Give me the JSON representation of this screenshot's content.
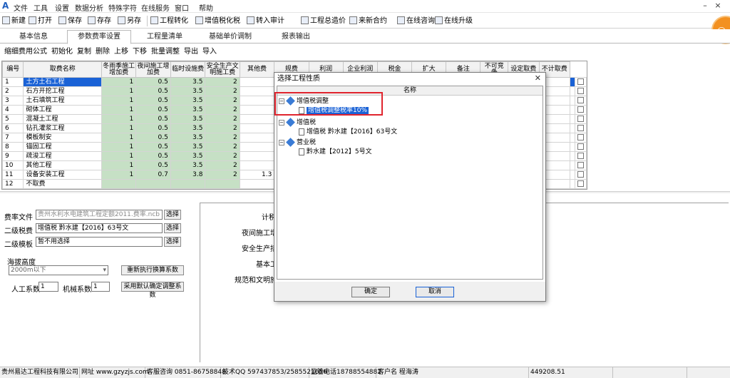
{
  "menubar": {
    "items": [
      "文件",
      "工具",
      "设置",
      "数据分析",
      "特殊字符",
      "在线服务",
      "窗口",
      "帮助"
    ]
  },
  "toolbar": {
    "items": [
      "新建",
      "打开",
      "保存",
      "存存",
      "另存",
      "工程转化",
      "增值税化税",
      "转入审计",
      "工程总造价",
      "来新合约",
      "在线咨询",
      "在线升级"
    ]
  },
  "tabs": [
    "基本信息",
    "参数费率设置",
    "工程量清单",
    "基础单价调制",
    "报表输出"
  ],
  "active_tab_index": 1,
  "subtoolbar": [
    "缩细费用公式",
    "初始化",
    "复制",
    "删除",
    "上移",
    "下移",
    "批量调整",
    "导出",
    "导入"
  ],
  "grid": {
    "headers": [
      "编号",
      "取费名称",
      "冬雨季施工增加费",
      "夜间施工增加费",
      "临时设施费",
      "安全生产文明施工费",
      "其他费",
      "规费",
      "利润",
      "企业利润",
      "税金",
      "扩大",
      "备注",
      "不可竞争",
      "设定取费",
      "不计取费"
    ],
    "rows": [
      {
        "no": "1",
        "name": "土方土石工程",
        "v1": "1",
        "v2": "0.5",
        "v3": "3.5",
        "v4": "2",
        "v5": ""
      },
      {
        "no": "2",
        "name": "石方开挖工程",
        "v1": "1",
        "v2": "0.5",
        "v3": "3.5",
        "v4": "2",
        "v5": ""
      },
      {
        "no": "3",
        "name": "土石填筑工程",
        "v1": "1",
        "v2": "0.5",
        "v3": "3.5",
        "v4": "2",
        "v5": ""
      },
      {
        "no": "4",
        "name": "砌体工程",
        "v1": "1",
        "v2": "0.5",
        "v3": "3.5",
        "v4": "2",
        "v5": ""
      },
      {
        "no": "5",
        "name": "混凝土工程",
        "v1": "1",
        "v2": "0.5",
        "v3": "3.5",
        "v4": "2",
        "v5": ""
      },
      {
        "no": "6",
        "name": "钻孔灌浆工程",
        "v1": "1",
        "v2": "0.5",
        "v3": "3.5",
        "v4": "2",
        "v5": ""
      },
      {
        "no": "7",
        "name": "模板制安",
        "v1": "1",
        "v2": "0.5",
        "v3": "3.5",
        "v4": "2",
        "v5": ""
      },
      {
        "no": "8",
        "name": "锚固工程",
        "v1": "1",
        "v2": "0.5",
        "v3": "3.5",
        "v4": "2",
        "v5": ""
      },
      {
        "no": "9",
        "name": "疏浚工程",
        "v1": "1",
        "v2": "0.5",
        "v3": "3.5",
        "v4": "2",
        "v5": ""
      },
      {
        "no": "10",
        "name": "其他工程",
        "v1": "1",
        "v2": "0.5",
        "v3": "3.5",
        "v4": "2",
        "v5": ""
      },
      {
        "no": "11",
        "name": "设备安装工程",
        "v1": "1",
        "v2": "0.7",
        "v3": "3.8",
        "v4": "2",
        "v5": "1.3"
      },
      {
        "no": "12",
        "name": "不取费",
        "v1": "",
        "v2": "",
        "v3": "",
        "v4": "",
        "v5": ""
      }
    ],
    "selected_row_index": 0
  },
  "left_panel": {
    "fee_file_label": "费率文件",
    "fee_file_value": "贵州水利水电建筑工程定额2011.费率.ncb",
    "second_tax_label": "二级税费",
    "second_tax_value": "增值税 黔水建【2016】63号文",
    "second_template_label": "二级模板",
    "second_template_value": "暂不用选择",
    "select_btn": "选择",
    "haiba_label": "海拔高度",
    "haiba_value": "2000m以下",
    "recalc_btn": "重新执行换算系数",
    "apply_btn": "采用默认确定调整系数",
    "rengong_label": "人工系数",
    "rengong_value": "1",
    "jixie_label": "机械系数",
    "jixie_value": "1"
  },
  "right_panel_labels": [
    "计税",
    "夜间施工增",
    "安全生产措",
    "基本工资",
    "规范和文明施"
  ],
  "dialog": {
    "title": "选择工程性质",
    "column_header": "名称",
    "tree": [
      {
        "label": "增值税调整",
        "level": 0,
        "expanded": true
      },
      {
        "label": "增值税调整税率10%",
        "level": 1,
        "selected": true
      },
      {
        "label": "增值税",
        "level": 0,
        "expanded": true
      },
      {
        "label": "增值税 黔水建【2016】63号文",
        "level": 1
      },
      {
        "label": "营业税",
        "level": 0,
        "expanded": true
      },
      {
        "label": "黔水建【2012】5号文",
        "level": 1
      }
    ],
    "ok_label": "确定",
    "cancel_label": "取消"
  },
  "status": {
    "company": "贵州易达工程科技有限公司",
    "website": "网址 www.gzyzjs.com",
    "consult": "客服咨询 0851-86758848",
    "tech": "技术QQ 597437853/2585521656",
    "supervisor": "监管电话18788554882",
    "user": "客户名 程海涛",
    "total": "449208.51"
  }
}
